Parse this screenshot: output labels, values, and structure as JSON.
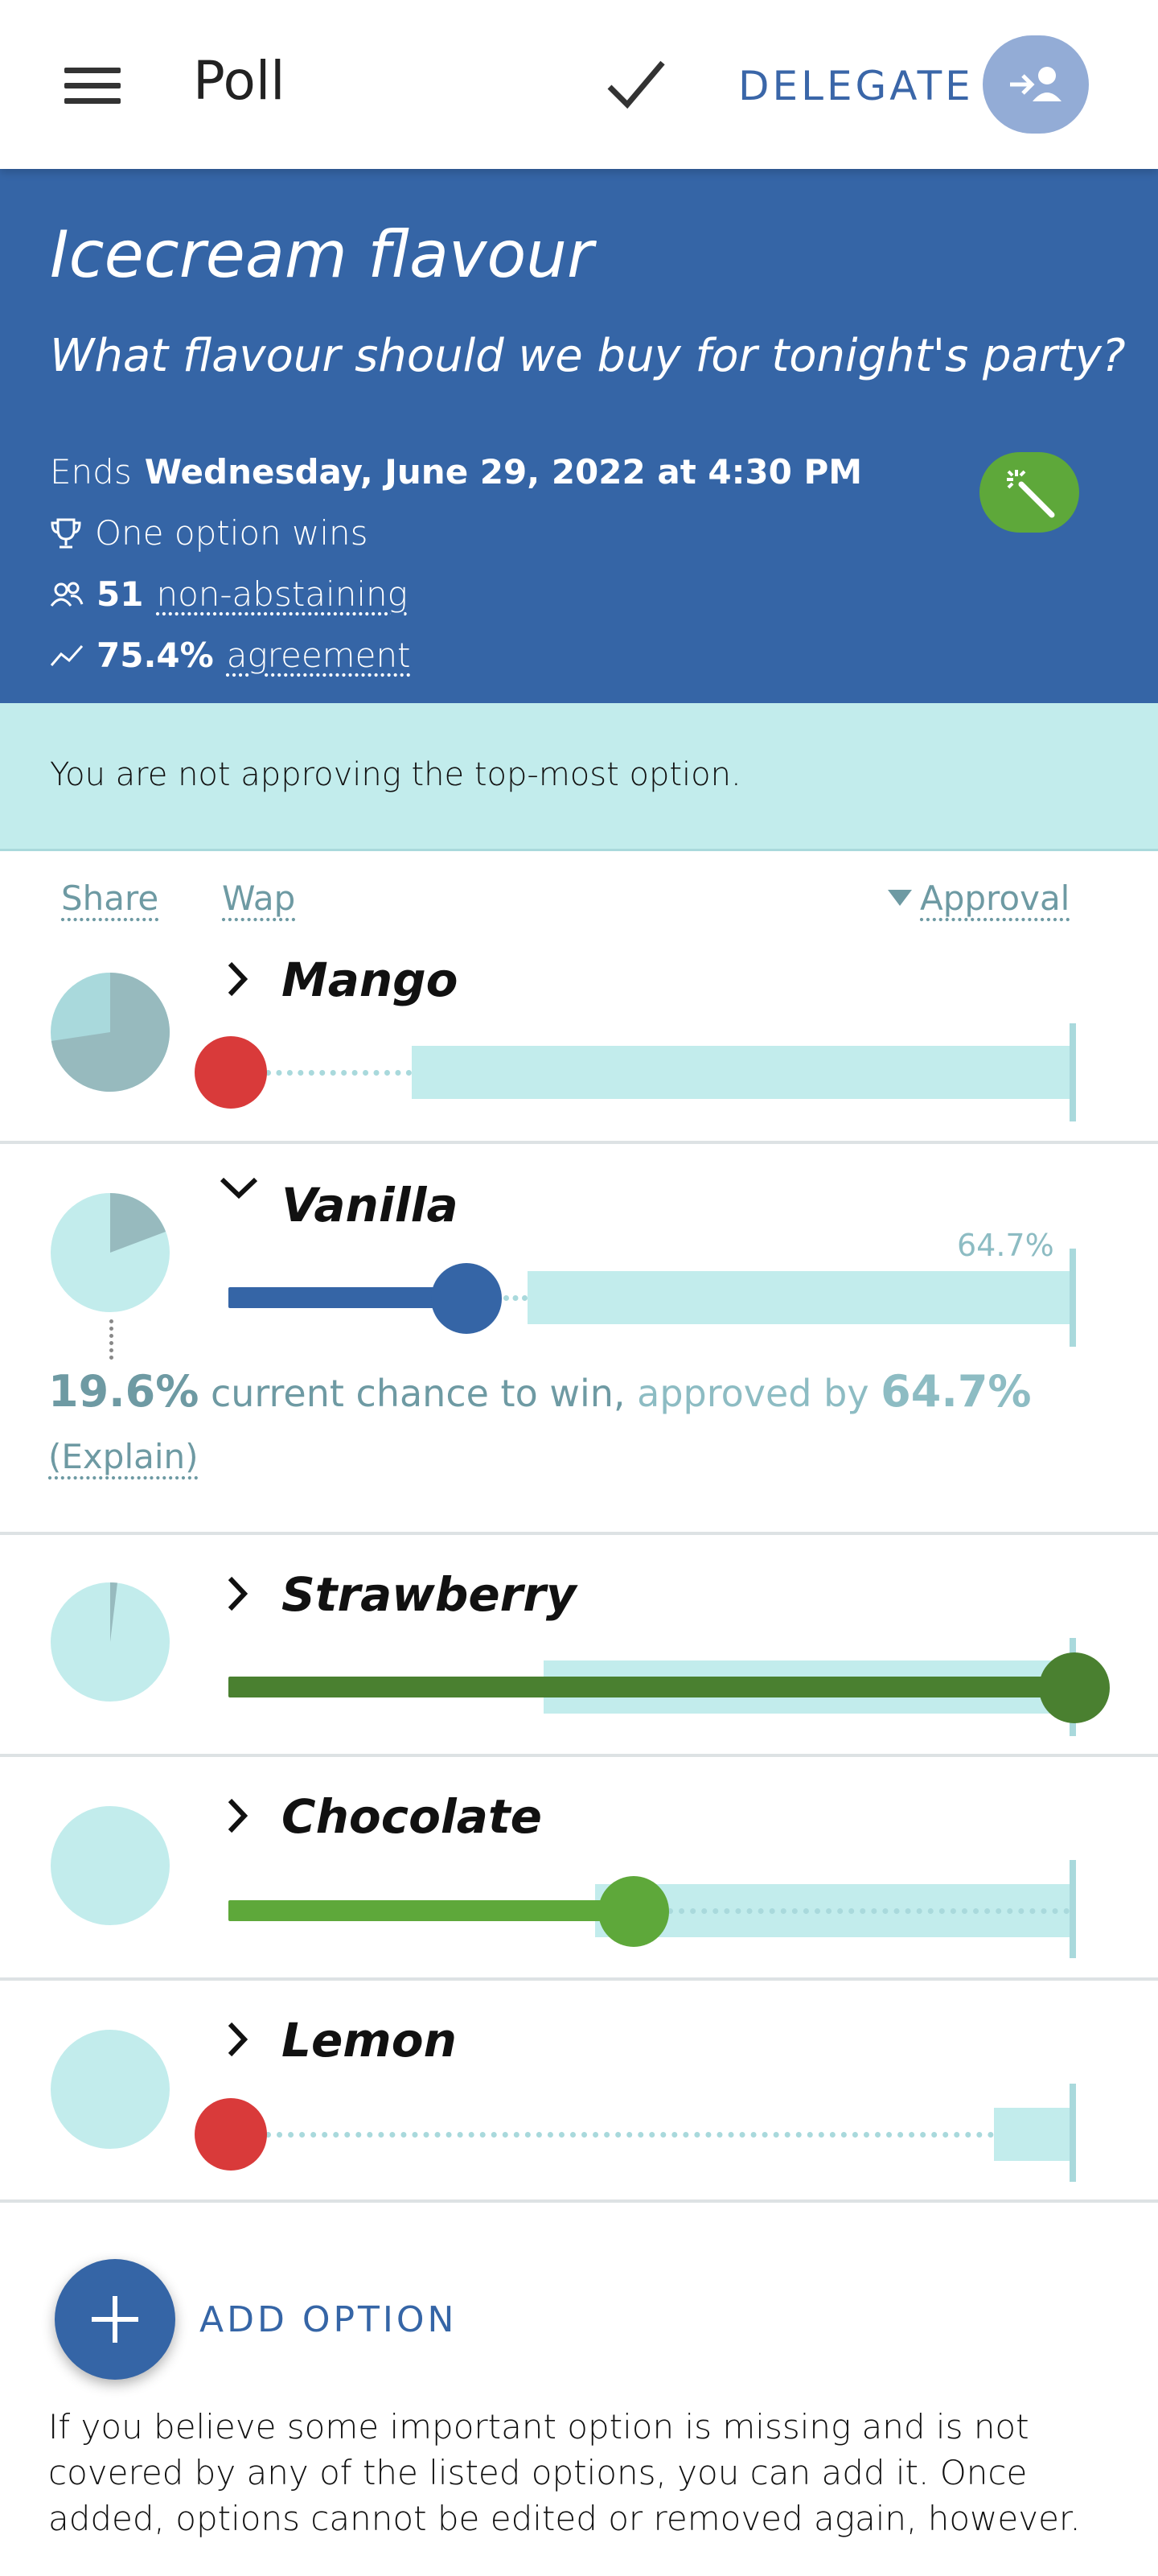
{
  "appbar": {
    "title": "Poll",
    "delegate_label": "DELEGATE",
    "icons": [
      "menu-icon",
      "check-icon",
      "delegate-icon"
    ]
  },
  "poll": {
    "title": "Icecream flavour",
    "question": "What flavour should we buy for tonight's party?",
    "ends_prefix": "Ends",
    "ends_date": "Wednesday, June 29, 2022 at 4:30 PM",
    "rule": "One option wins",
    "participants_count": "51",
    "participants_label": "non-abstaining",
    "agreement_value": "75.4%",
    "agreement_label": "agreement"
  },
  "notice": "You are not approving the top-most option.",
  "columns": {
    "share": "Share",
    "wap": "Wap",
    "approval": "Approval"
  },
  "colors": {
    "primary": "#3565a6",
    "teal_light": "#c2ecec",
    "teal_track": "#a9d9dc",
    "reject": "#d93a3a",
    "approve_dark": "#4a8030",
    "approve_light": "#5ea83a",
    "neutral_blue": "#3565a6"
  },
  "options": [
    {
      "name": "Mango",
      "expanded": false,
      "share": 0.74,
      "approval": 0.67,
      "vote": "reject"
    },
    {
      "name": "Vanilla",
      "expanded": true,
      "share": 0.196,
      "approval": 0.647,
      "vote": "neutral",
      "approval_label": "64.7%"
    },
    {
      "name": "Strawberry",
      "expanded": false,
      "share": 0.02,
      "approval": 0.53,
      "vote": "approve-full"
    },
    {
      "name": "Chocolate",
      "expanded": false,
      "share": 0.0,
      "approval": 0.49,
      "vote": "approve-partial"
    },
    {
      "name": "Lemon",
      "expanded": false,
      "share": 0.0,
      "approval": 0.1,
      "vote": "reject"
    }
  ],
  "vanilla_detail": {
    "chance_value": "19.6%",
    "chance_text": "current chance to win,",
    "approved_text": "approved by",
    "approved_value": "64.7%",
    "explain": "(Explain)"
  },
  "add_option": {
    "label": "ADD OPTION",
    "help": "If you believe some important option is missing and is not covered by any of the listed options, you can add it. Once added, options cannot be edited or removed again, however."
  }
}
